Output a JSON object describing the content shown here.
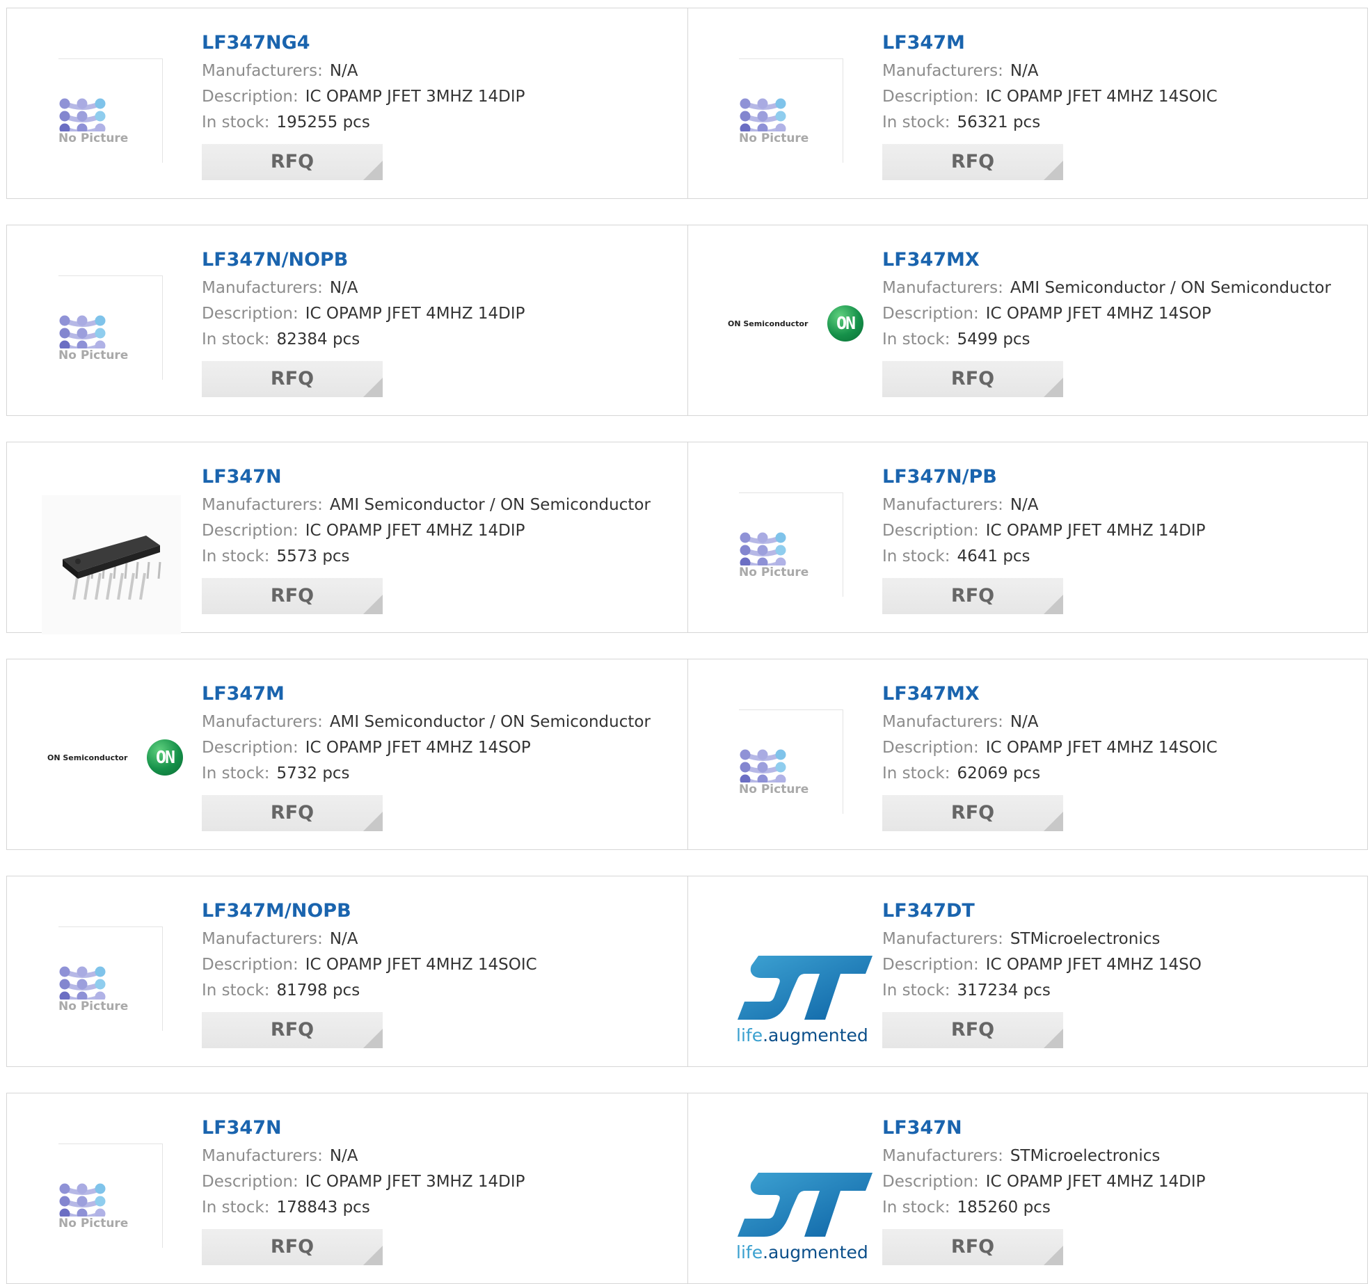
{
  "labels": {
    "manufacturers": "Manufacturers:",
    "description": "Description:",
    "in_stock": "In stock:",
    "rfq": "RFQ",
    "no_picture": "No Picture"
  },
  "brands": {
    "onsemi_text": "ON Semiconductor",
    "onsemi_badge": "ON",
    "st_tag_life": "life",
    "st_tag_rest": ".augmented"
  },
  "products": [
    {
      "part": "LF347NG4",
      "manufacturer": "N/A",
      "description": "IC OPAMP JFET 3MHZ 14DIP",
      "stock": "195255 pcs",
      "image": "no-picture"
    },
    {
      "part": "LF347M",
      "manufacturer": "N/A",
      "description": "IC OPAMP JFET 4MHZ 14SOIC",
      "stock": "56321 pcs",
      "image": "no-picture"
    },
    {
      "part": "LF347N/NOPB",
      "manufacturer": "N/A",
      "description": "IC OPAMP JFET 4MHZ 14DIP",
      "stock": "82384 pcs",
      "image": "no-picture"
    },
    {
      "part": "LF347MX",
      "manufacturer": "AMI Semiconductor / ON Semiconductor",
      "description": "IC OPAMP JFET 4MHZ 14SOP",
      "stock": "5499 pcs",
      "image": "onsemi"
    },
    {
      "part": "LF347N",
      "manufacturer": "AMI Semiconductor / ON Semiconductor",
      "description": "IC OPAMP JFET 4MHZ 14DIP",
      "stock": "5573 pcs",
      "image": "dip-chip"
    },
    {
      "part": "LF347N/PB",
      "manufacturer": "N/A",
      "description": "IC OPAMP JFET 4MHZ 14DIP",
      "stock": "4641 pcs",
      "image": "no-picture"
    },
    {
      "part": "LF347M",
      "manufacturer": "AMI Semiconductor / ON Semiconductor",
      "description": "IC OPAMP JFET 4MHZ 14SOP",
      "stock": "5732 pcs",
      "image": "onsemi"
    },
    {
      "part": "LF347MX",
      "manufacturer": "N/A",
      "description": "IC OPAMP JFET 4MHZ 14SOIC",
      "stock": "62069 pcs",
      "image": "no-picture"
    },
    {
      "part": "LF347M/NOPB",
      "manufacturer": "N/A",
      "description": "IC OPAMP JFET 4MHZ 14SOIC",
      "stock": "81798 pcs",
      "image": "no-picture"
    },
    {
      "part": "LF347DT",
      "manufacturer": "STMicroelectronics",
      "description": "IC OPAMP JFET 4MHZ 14SO",
      "stock": "317234 pcs",
      "image": "st"
    },
    {
      "part": "LF347N",
      "manufacturer": "N/A",
      "description": "IC OPAMP JFET 3MHZ 14DIP",
      "stock": "178843 pcs",
      "image": "no-picture"
    },
    {
      "part": "LF347N",
      "manufacturer": "STMicroelectronics",
      "description": "IC OPAMP JFET 4MHZ 14DIP",
      "stock": "185260 pcs",
      "image": "st"
    }
  ]
}
